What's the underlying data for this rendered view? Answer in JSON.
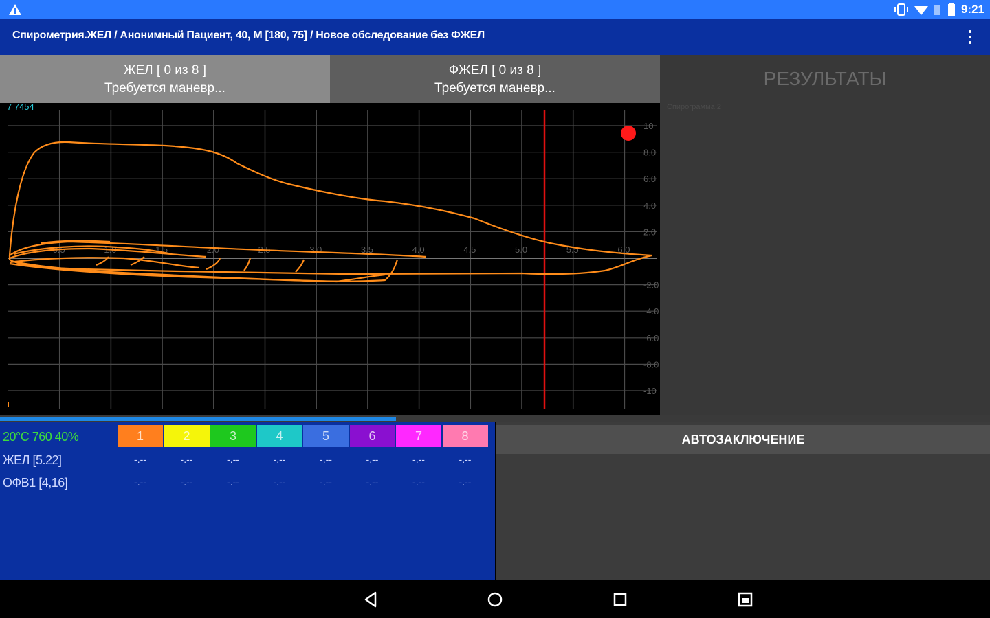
{
  "status": {
    "time": "9:21"
  },
  "appbar": {
    "title": "Спирометрия.ЖЕЛ  /  Анонимный Пациент, 40, М [180, 75]  /  Новое обследование без ФЖЕЛ"
  },
  "tabs": [
    {
      "line1": "ЖЕЛ  [ 0 из 8 ]",
      "line2": "Требуется маневр..."
    },
    {
      "line1": "ФЖЕЛ  [ 0 из 8 ]",
      "line2": "Требуется маневр..."
    },
    {
      "label": "РЕЗУЛЬТАТЫ"
    }
  ],
  "chart": {
    "corner_label": "7 7454",
    "x_ticks": [
      "0.5",
      "1.0",
      "1.5",
      "2.0",
      "2.5",
      "3.0",
      "3.5",
      "4.0",
      "4.5",
      "5.0",
      "5.5",
      "6.0"
    ],
    "y_ticks": [
      "10",
      "8.0",
      "6.0",
      "4.0",
      "2.0",
      "-2.0",
      "-4.0",
      "-6.0",
      "-8.0",
      "-10"
    ],
    "colors": {
      "curve": "#ff8c1a",
      "marker": "#ff1a1a",
      "cursor": "#e01010",
      "grid": "#4a4a4a"
    }
  },
  "results_panel": {
    "caption": "Спирограмма 2"
  },
  "progress": {
    "fraction": 0.4
  },
  "table": {
    "env": "20°C 760 40%",
    "attempts": [
      {
        "n": "1",
        "color": "#ff7f1e"
      },
      {
        "n": "2",
        "color": "#f5f50a"
      },
      {
        "n": "3",
        "color": "#1ec81e"
      },
      {
        "n": "4",
        "color": "#1ec8c8"
      },
      {
        "n": "5",
        "color": "#3a6ee0"
      },
      {
        "n": "6",
        "color": "#8a10d0"
      },
      {
        "n": "7",
        "color": "#ff28ff"
      },
      {
        "n": "8",
        "color": "#ff7ab0"
      }
    ],
    "rows": [
      {
        "label": "ЖЕЛ [5.22]",
        "values": [
          "-.--",
          "-.--",
          "-.--",
          "-.--",
          "-.--",
          "-.--",
          "-.--",
          "-.--"
        ]
      },
      {
        "label": "ОФВ1 [4,16]",
        "values": [
          "-.--",
          "-.--",
          "-.--",
          "-.--",
          "-.--",
          "-.--",
          "-.--",
          "-.--"
        ]
      }
    ]
  },
  "autoconclusion": {
    "title": "АВТОЗАКЛЮЧЕНИЕ"
  },
  "icons": {
    "warning": "warning-icon",
    "vibrate": "vibrate-icon",
    "wifi": "wifi-icon",
    "battery": "battery-icon",
    "more": "more-vert-icon",
    "back": "back-icon",
    "home": "home-icon",
    "recents": "recents-icon",
    "split": "split-screen-icon"
  }
}
